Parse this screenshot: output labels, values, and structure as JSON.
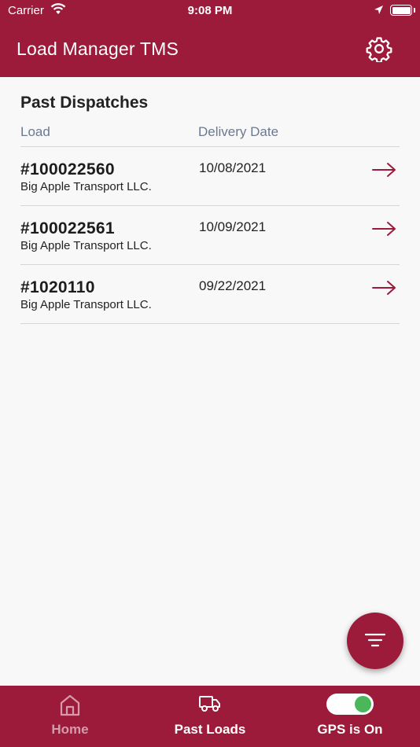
{
  "status_bar": {
    "carrier": "Carrier",
    "time": "9:08 PM"
  },
  "header": {
    "title": "Load Manager TMS",
    "settings_icon": "gear-icon"
  },
  "main": {
    "section_title": "Past Dispatches",
    "columns": {
      "load": "Load",
      "delivery_date": "Delivery Date"
    },
    "dispatches": [
      {
        "load": "#100022560",
        "company": "Big Apple Transport LLC.",
        "delivery_date": "10/08/2021"
      },
      {
        "load": "#100022561",
        "company": "Big Apple Transport LLC.",
        "delivery_date": "10/09/2021"
      },
      {
        "load": "#1020110",
        "company": "Big Apple Transport LLC.",
        "delivery_date": "09/22/2021"
      }
    ]
  },
  "fab": {
    "icon": "filter-icon"
  },
  "tab_bar": {
    "home_label": "Home",
    "past_loads_label": "Past Loads",
    "gps_label": "GPS is On",
    "gps_on": true
  },
  "colors": {
    "brand": "#9c1b3a",
    "toggle_on": "#4cb65a",
    "column_header": "#6b7a90"
  }
}
